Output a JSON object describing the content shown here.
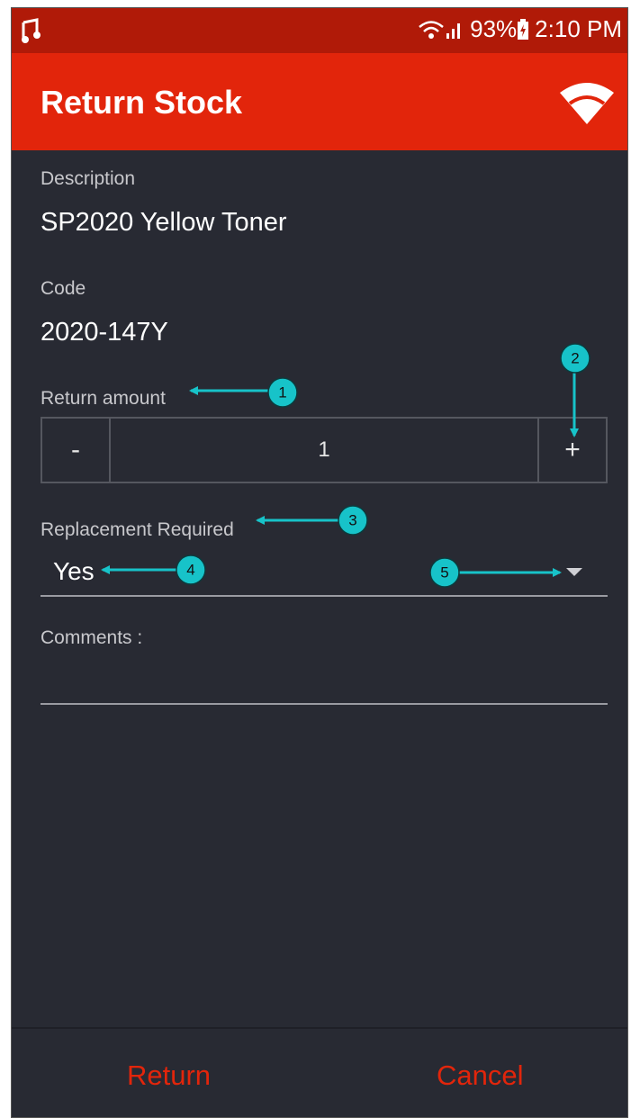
{
  "status_bar": {
    "battery": "93%",
    "time": "2:10 PM",
    "icons": [
      "music-note-icon",
      "wifi-signal-icon",
      "cell-signal-icon",
      "battery-charging-icon"
    ]
  },
  "app_bar": {
    "title": "Return Stock",
    "icon": "wifi-icon"
  },
  "form": {
    "description_label": "Description",
    "description_value": "SP2020 Yellow Toner",
    "code_label": "Code",
    "code_value": "2020-147Y",
    "return_amount_label": "Return amount",
    "stepper": {
      "minus": "-",
      "value": "1",
      "plus": "+"
    },
    "replacement_label": "Replacement Required",
    "replacement_value": "Yes",
    "comments_label": "Comments :",
    "comments_value": ""
  },
  "bottom_bar": {
    "return_label": "Return",
    "cancel_label": "Cancel"
  },
  "annotations": {
    "badges": [
      "1",
      "2",
      "3",
      "4",
      "5"
    ],
    "accent_color": "#17c3c9"
  },
  "colors": {
    "status_bar": "#b01a08",
    "app_bar": "#e2250b",
    "background": "#282a33",
    "action_text": "#e2250b"
  }
}
